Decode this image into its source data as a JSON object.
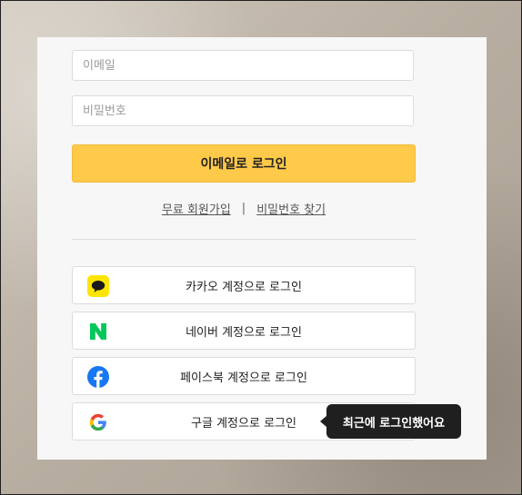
{
  "form": {
    "email_placeholder": "이메일",
    "password_placeholder": "비밀번호",
    "email_login_label": "이메일로 로그인"
  },
  "links": {
    "signup": "무료 회원가입",
    "separator": "|",
    "find_password": "비밀번호 찾기"
  },
  "social": {
    "kakao": {
      "label": "카카오 계정으로 로그인",
      "icon": "kakao-talk-icon",
      "color": "#FEE500"
    },
    "naver": {
      "label": "네이버 계정으로 로그인",
      "icon": "naver-n-icon",
      "color": "#03C75A"
    },
    "facebook": {
      "label": "페이스북 계정으로 로그인",
      "icon": "facebook-icon",
      "color": "#1877F2"
    },
    "google": {
      "label": "구글 계정으로 로그인",
      "icon": "google-g-icon"
    }
  },
  "tooltip": {
    "recent_login": "최근에 로그인했어요"
  },
  "colors": {
    "primary_button": "#FFC94A",
    "tooltip_bg": "#1F1F1F"
  }
}
